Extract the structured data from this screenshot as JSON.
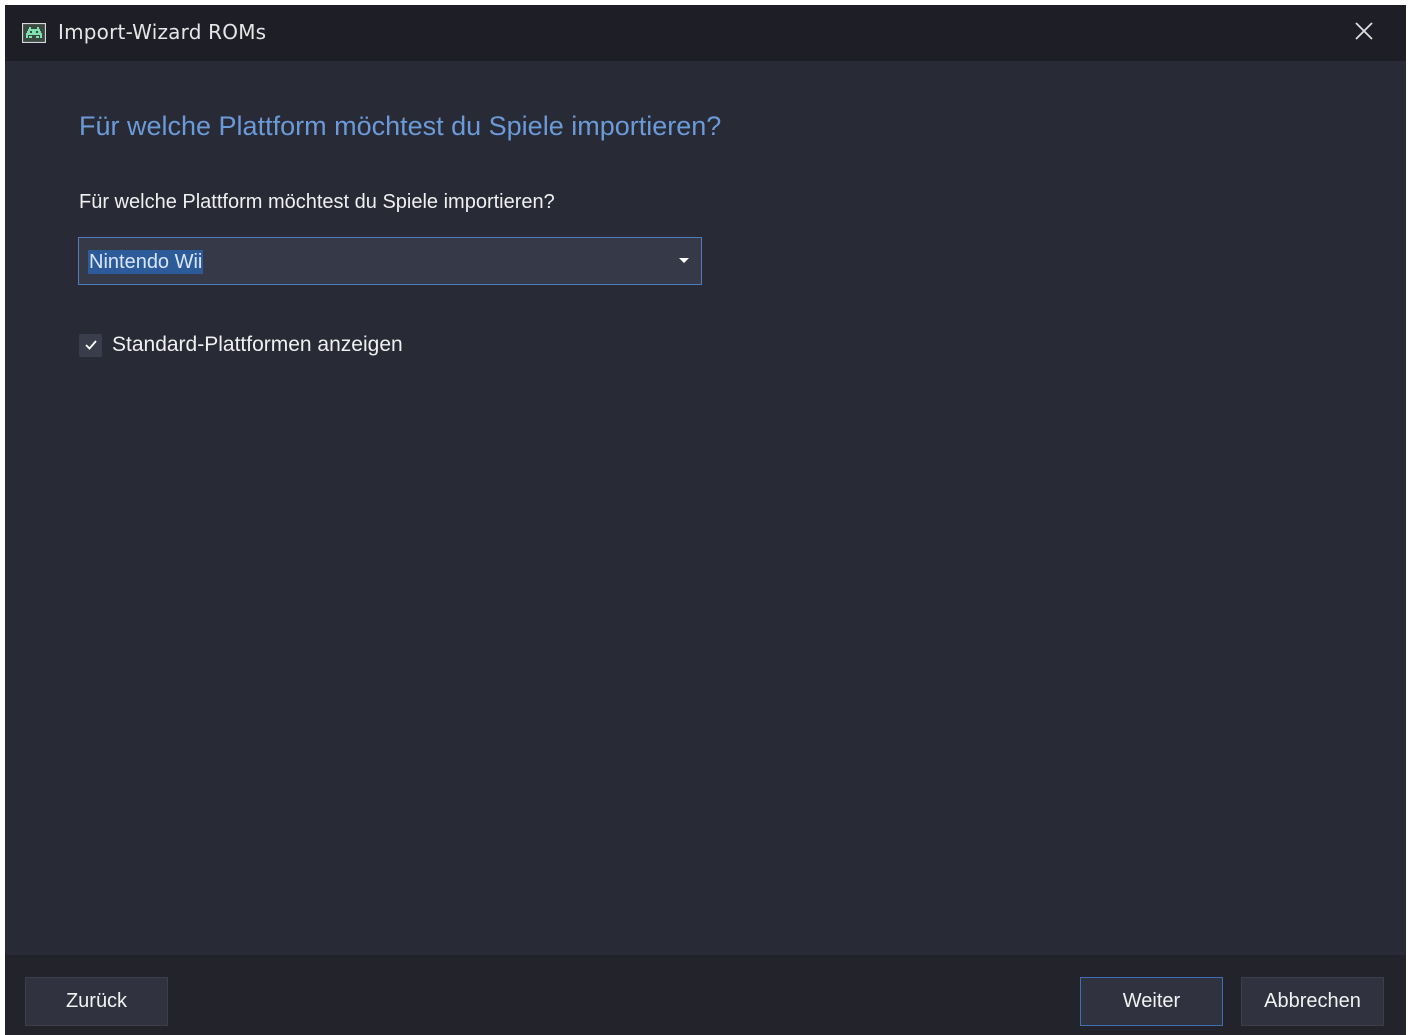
{
  "window": {
    "title": "Import-Wizard ROMs",
    "icon": "space-invader-icon",
    "close_icon": "close-icon"
  },
  "main": {
    "heading": "Für welche Plattform möchtest du Spiele importieren?",
    "question": "Für welche Plattform möchtest du Spiele importieren?",
    "platform_select": {
      "selected": "Nintendo Wii"
    },
    "show_default_platforms": {
      "label": "Standard-Plattformen anzeigen",
      "checked": true
    }
  },
  "footer": {
    "back_label": "Zurück",
    "next_label": "Weiter",
    "cancel_label": "Abbrechen"
  },
  "colors": {
    "accent": "#6a9ad8",
    "background": "#282a35",
    "titlebar": "#1e1f26",
    "selection": "#2d5b9a"
  }
}
